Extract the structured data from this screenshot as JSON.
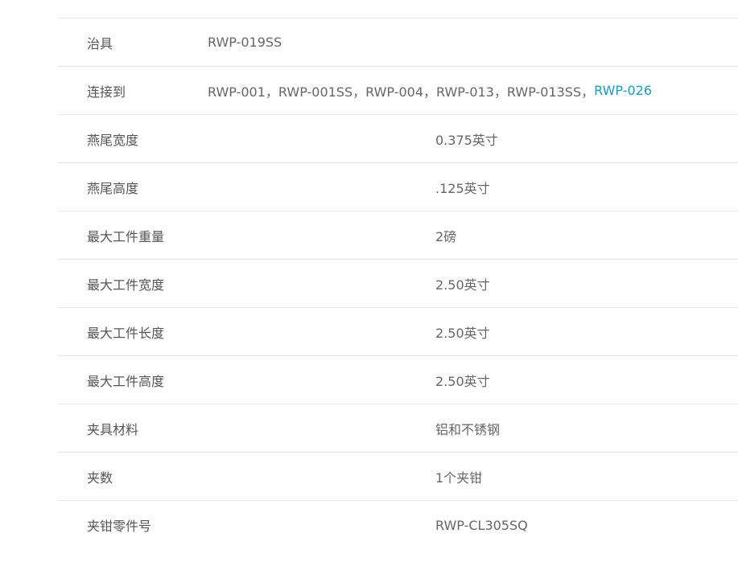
{
  "specs": {
    "rows": [
      {
        "label": "治具",
        "value": "RWP-019SS"
      },
      {
        "label": "连接到",
        "value_plain": "RWP-001，RWP-001SS，RWP-004，RWP-013，RWP-013SS，",
        "value_link": "RWP-026"
      },
      {
        "label": "燕尾宽度",
        "value": "0.375英寸"
      },
      {
        "label": "燕尾高度",
        "value": ".125英寸"
      },
      {
        "label": "最大工件重量",
        "value": "2磅"
      },
      {
        "label": "最大工件宽度",
        "value": "2.50英寸"
      },
      {
        "label": "最大工件长度",
        "value": "2.50英寸"
      },
      {
        "label": "最大工件高度",
        "value": "2.50英寸"
      },
      {
        "label": "夹具材料",
        "value": "铝和不锈钢"
      },
      {
        "label": "夹数",
        "value": "1个夹钳"
      },
      {
        "label": "夹钳零件号",
        "value": "RWP-CL305SQ"
      }
    ]
  },
  "colors": {
    "link": "#1a9bc7",
    "border": "#e6e6e6",
    "text": "#555555"
  }
}
